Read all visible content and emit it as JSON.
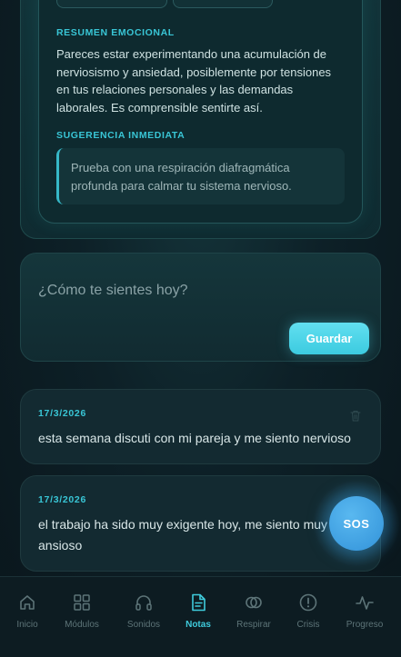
{
  "analysis": {
    "summary_label": "RESUMEN EMOCIONAL",
    "summary_text": "Pareces estar experimentando una acumulación de nerviosismo y ansiedad, posiblemente por tensiones en tus relaciones personales y las demandas laborales. Es comprensible sentirte así.",
    "suggestion_label": "SUGERENCIA INMEDIATA",
    "suggestion_text": "Prueba con una respiración diafragmática profunda para calmar tu sistema nervioso."
  },
  "entry": {
    "placeholder": "¿Cómo te sientes hoy?",
    "value": "",
    "save_label": "Guardar"
  },
  "notes": [
    {
      "date": "17/3/2026",
      "text": "esta semana discuti con mi pareja y me siento nervioso"
    },
    {
      "date": "17/3/2026",
      "text": "el trabajo ha sido muy exigente hoy, me siento muy ansioso"
    }
  ],
  "sos": {
    "label": "SOS"
  },
  "nav": {
    "items": [
      {
        "label": "Inicio",
        "icon": "home-icon"
      },
      {
        "label": "Módulos",
        "icon": "grid-icon"
      },
      {
        "label": "Sonidos",
        "icon": "headphones-icon"
      },
      {
        "label": "Notas",
        "icon": "notes-icon",
        "active": true
      },
      {
        "label": "Respirar",
        "icon": "breath-icon"
      },
      {
        "label": "Crisis",
        "icon": "alert-icon"
      },
      {
        "label": "Progreso",
        "icon": "activity-icon"
      }
    ]
  },
  "colors": {
    "accent": "#39c6d6",
    "button": "#4fd6ea",
    "sos": "#3e9ee0",
    "nav_active": "#3fcbdc",
    "nav_inactive": "#5d7478"
  }
}
